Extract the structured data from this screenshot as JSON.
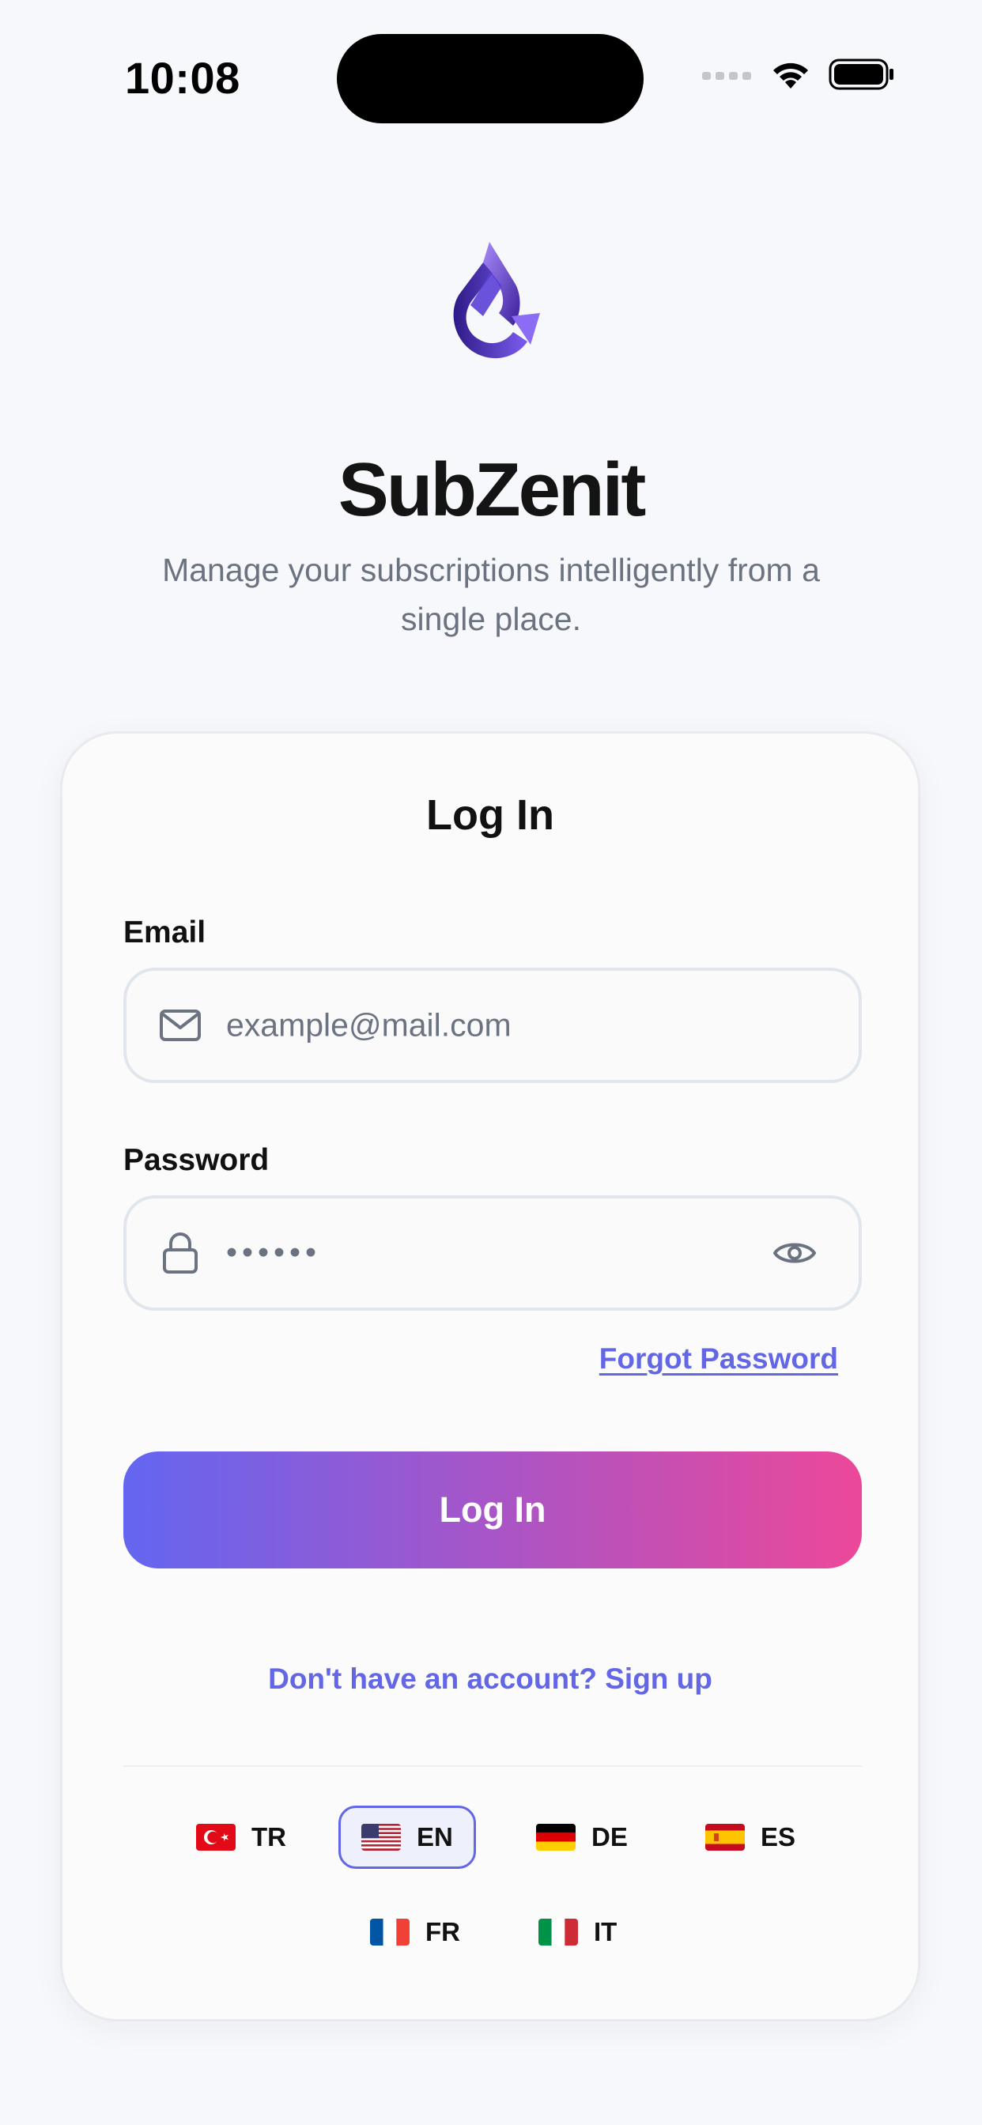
{
  "status_bar": {
    "time": "10:08"
  },
  "app": {
    "name": "SubZenit",
    "tagline": "Manage your subscriptions intelligently from a single place."
  },
  "login_card": {
    "title": "Log In",
    "email": {
      "label": "Email",
      "placeholder": "example@mail.com"
    },
    "password": {
      "label": "Password",
      "value": "••••••"
    },
    "forgot_password": "Forgot Password",
    "submit_label": "Log In",
    "signup_prompt": "Don't have an account? Sign up"
  },
  "languages": {
    "selected": "EN",
    "items": [
      {
        "code": "TR",
        "flag": "turkey-flag"
      },
      {
        "code": "EN",
        "flag": "usa-flag"
      },
      {
        "code": "DE",
        "flag": "germany-flag"
      },
      {
        "code": "ES",
        "flag": "spain-flag"
      },
      {
        "code": "FR",
        "flag": "france-flag"
      },
      {
        "code": "IT",
        "flag": "italy-flag"
      }
    ]
  },
  "colors": {
    "accent": "#6366e5",
    "gradient_start": "#6366f1",
    "gradient_mid": "#a855c7",
    "gradient_end": "#ec4899",
    "muted_text": "#6b7280"
  },
  "icons": {
    "email_field": "envelope-icon",
    "password_field": "lock-icon",
    "password_toggle": "eye-icon"
  }
}
